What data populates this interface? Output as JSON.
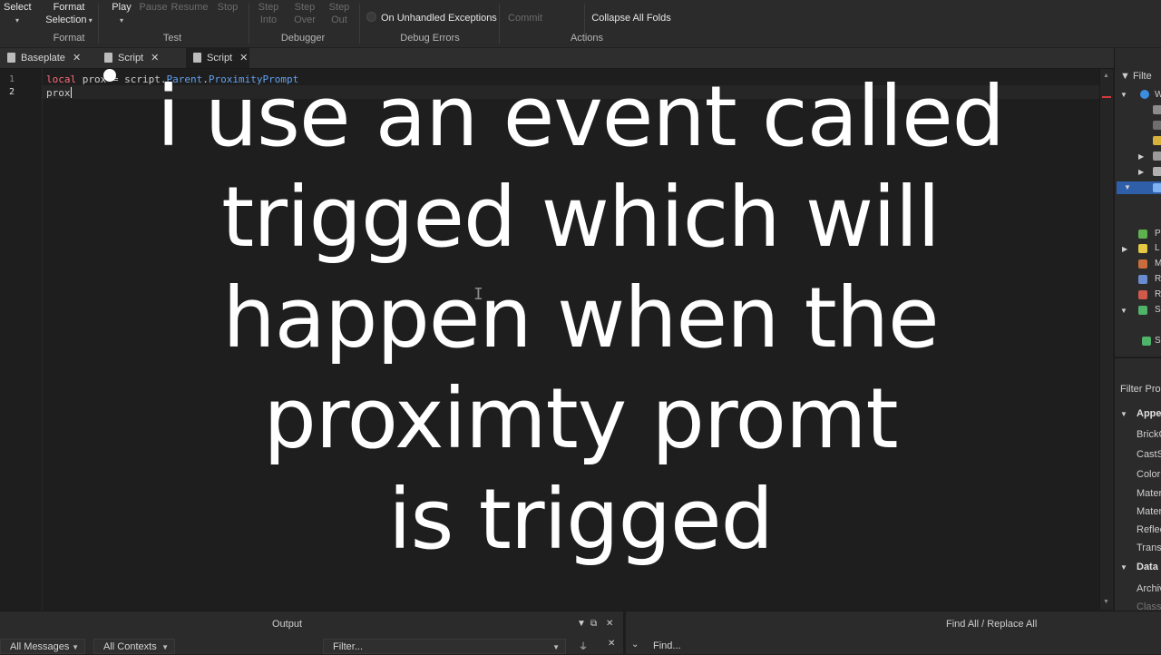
{
  "ribbon": {
    "select_label": "Select",
    "format_selection_label_1": "Format",
    "format_selection_label_2": "Selection",
    "format_group": "Format",
    "play_label": "Play",
    "pause_label": "Pause",
    "resume_label": "Resume",
    "stop_label": "Stop",
    "test_group": "Test",
    "step_into_1": "Step",
    "step_into_2": "Into",
    "step_over_1": "Step",
    "step_over_2": "Over",
    "step_out_1": "Step",
    "step_out_2": "Out",
    "debugger_group": "Debugger",
    "on_unhandled_exceptions": "On Unhandled Exceptions",
    "debug_errors_group": "Debug Errors",
    "commit_label": "Commit",
    "collapse_all_folds": "Collapse All Folds",
    "actions_group": "Actions"
  },
  "tabs": [
    {
      "label": "Baseplate"
    },
    {
      "label": "Script"
    },
    {
      "label": "Script"
    }
  ],
  "editor": {
    "line_numbers": [
      "1",
      "2"
    ],
    "line1": {
      "kw": "local",
      "var": "prox",
      "eq": " = ",
      "obj": "script",
      "dot1": ".",
      "p1": "Parent",
      "dot2": ".",
      "p2": "ProximityPrompt"
    },
    "line2": "prox"
  },
  "explorer": {
    "filter_label": "Filte",
    "letters": [
      "W",
      "P",
      "L",
      "M",
      "R",
      "R",
      "S",
      "S"
    ]
  },
  "properties": {
    "filter_label": "Filter Pro",
    "appearance_category": "Appe",
    "rows": [
      "BrickC",
      "CastS",
      "Color",
      "Mater",
      "Mater",
      "Reflec",
      "Trans"
    ],
    "data_category": "Data",
    "data_rows": [
      "Archiv",
      "Class"
    ]
  },
  "output": {
    "title": "Output",
    "all_messages": "All Messages",
    "all_contexts": "All Contexts",
    "filter_placeholder": "Filter..."
  },
  "find": {
    "title": "Find All / Replace All",
    "find_placeholder": "Find..."
  },
  "caption": {
    "line1": "i use an event called",
    "line2": "trigged which will",
    "line3": "happen when the",
    "line4": "proximty promt",
    "line5": "is trigged"
  }
}
